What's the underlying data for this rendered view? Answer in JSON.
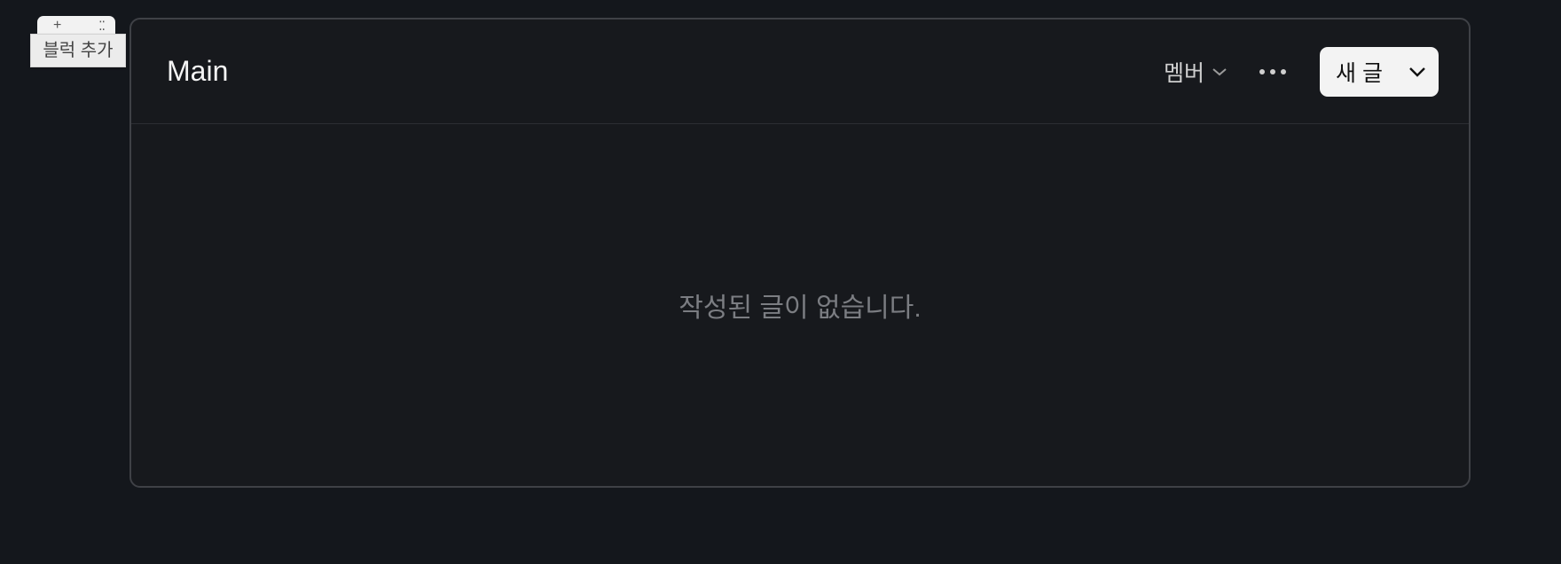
{
  "block_controls": {
    "add_icon": "plus-icon",
    "drag_icon": "drag-handle-icon",
    "tooltip": "블럭 추가"
  },
  "card": {
    "title": "Main",
    "member_dropdown_label": "멤버",
    "more_icon": "more-horizontal-icon",
    "new_post_label": "새 글",
    "empty_message": "작성된 글이 없습니다."
  }
}
